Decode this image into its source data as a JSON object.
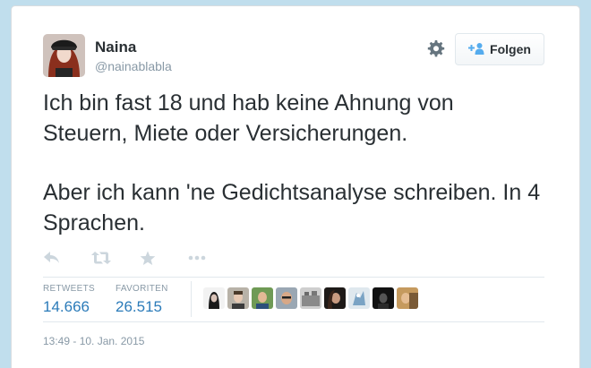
{
  "tweet": {
    "author": {
      "display_name": "Naina",
      "handle": "@nainablabla"
    },
    "follow_label": "Folgen",
    "paragraphs": [
      "Ich bin fast 18 und hab keine Ahnung von Steuern, Miete oder Versicherungen.",
      "Aber ich kann 'ne Gedichtsanalyse schreiben. In 4 Sprachen."
    ],
    "stats": {
      "retweets_label": "RETWEETS",
      "retweets_value": "14.666",
      "favorites_label": "FAVORITEN",
      "favorites_value": "26.515"
    },
    "timestamp": "13:49 - 10. Jan. 2015"
  },
  "icons": {
    "settings": "gear-icon",
    "follow": "add-user-icon",
    "reply": "reply-icon",
    "retweet": "retweet-icon",
    "favorite": "star-icon",
    "more": "more-icon"
  },
  "colors": {
    "page_background": "#c0deed",
    "link_blue": "#2b7bb9",
    "text_primary": "#292f33",
    "text_secondary": "#8899a6",
    "icon_gray": "#ccd6dd"
  }
}
